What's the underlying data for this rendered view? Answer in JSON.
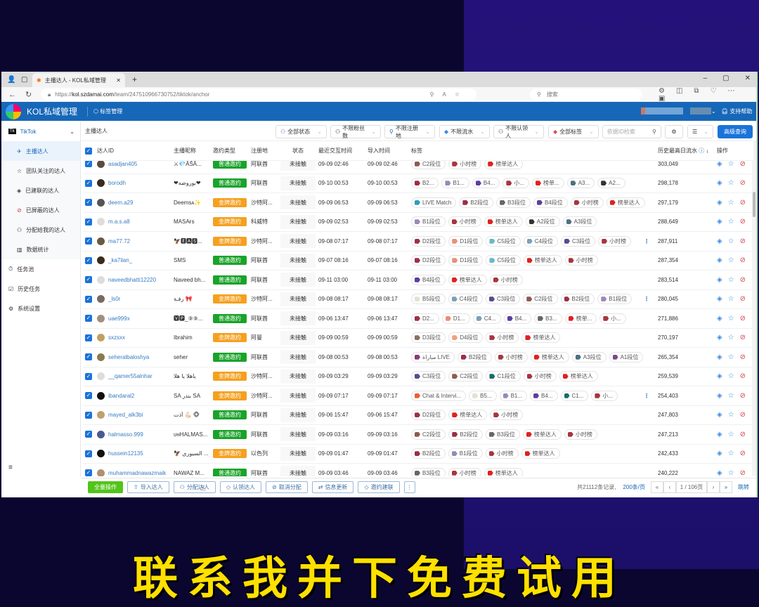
{
  "banner": {
    "bottom": "联系我并下免费试用"
  },
  "browser": {
    "tab_title": "主播达人 - KOL私域管理",
    "url_prefix": "https://",
    "url_host": "kol.szdamai.com",
    "url_path": "/team/247510966730752/tiktok/anchor",
    "search_placeholder": "搜索"
  },
  "app": {
    "title": "KOL私域管理",
    "tag_manage": "标签管理",
    "help": "支持帮助",
    "brand_color": "#1767b8"
  },
  "sidebar": {
    "platform": "TikTok",
    "items": [
      {
        "label": "主播达人",
        "icon": "anchor-icon",
        "active": true
      },
      {
        "label": "团队关注的达人",
        "icon": "star-icon"
      },
      {
        "label": "已建联的达人",
        "icon": "handshake-icon"
      },
      {
        "label": "已屏蔽的达人",
        "icon": "block-icon"
      },
      {
        "label": "分配给我的达人",
        "icon": "user-check-icon"
      },
      {
        "label": "数据统计",
        "icon": "chart-icon"
      }
    ],
    "top_items": [
      {
        "label": "任务池",
        "icon": "timer-icon"
      },
      {
        "label": "历史任务",
        "icon": "clipboard-icon"
      },
      {
        "label": "系统设置",
        "icon": "gear-icon"
      }
    ]
  },
  "filters": {
    "breadcrumb": "主播达人",
    "status": "全部状态",
    "fans": "不限粉丝数",
    "region": "不限注册地",
    "flow": "不限流水",
    "claimer": "不限认领人",
    "tags": "全部标签",
    "search_placeholder": "依据ID检索",
    "advanced": "高级查询"
  },
  "table": {
    "headers": [
      "达人ID",
      "主播昵称",
      "邀约类型",
      "注册地",
      "状态",
      "最近交互时间",
      "导入时间",
      "标签",
      "历史最高日流水",
      "操作"
    ],
    "type_colors": {
      "普通邀约": "#1aa32a",
      "金牌邀约": "#f5a020"
    },
    "tag_colors": {
      "C2段位": "#8d5a4f",
      "小时榜": "#a8343f",
      "榜单达人": "#e02020",
      "B2段位": "#9c2d44",
      "B1段位": "#9a88b8",
      "B4段位": "#5b3ea0",
      "A3段位": "#4d7080",
      "A2段位": "#333333",
      "LIVE Match": "#2aa0b8",
      "B3段位": "#666666",
      "D2段位": "#9c3048",
      "D1段位": "#e8907a",
      "C5段位": "#6ab8c8",
      "C4段位": "#7aa0b8",
      "C3段位": "#5a4a8a",
      "B5段位": "#dde4d0",
      "D3段位": "#8a7060",
      "D4段位": "#f0a080",
      "مباراة LIVE": "#8a3a7a",
      "A1段位": "#7a4a8a",
      "C1段位": "#1a6a6a",
      "Chat & Intervi": "#e86030"
    },
    "rows": [
      {
        "id": "asadjan405",
        "nick": "⚔💎ĀŠĀ...",
        "type": "普通邀约",
        "region": "阿联酋",
        "status": "未接触",
        "last": "09-09 02:46",
        "imported": "09-09 02:46",
        "tags": [
          "C2段位",
          "小时榜",
          "榜单达人"
        ],
        "more": false,
        "max": "303,049"
      },
      {
        "id": "borodh",
        "nick": "❤بوروضه❤",
        "type": "普通邀约",
        "region": "阿联酋",
        "status": "未接触",
        "last": "09-10 00:53",
        "imported": "09-10 00:53",
        "tags": [
          "B2...",
          "B1...",
          "B4...",
          "小...",
          "榜单...",
          "A3...",
          "A2..."
        ],
        "more": false,
        "max": "298,178"
      },
      {
        "id": "deem.a29",
        "nick": "Deemsᴀ✨",
        "type": "金牌邀约",
        "region": "沙特阿...",
        "status": "未接触",
        "last": "09-09 06:53",
        "imported": "09-09 06:53",
        "tags": [
          "LIVE Match",
          "B2段位",
          "B3段位",
          "B4段位",
          "小时榜",
          "榜单达人"
        ],
        "more": false,
        "max": "297,179"
      },
      {
        "id": "m.a.s.a8",
        "nick": "MASAғs",
        "type": "金牌邀约",
        "region": "科威特",
        "status": "未接触",
        "last": "09-09 02:53",
        "imported": "09-09 02:53",
        "tags": [
          "B1段位",
          "小时榜",
          "榜单达人",
          "A2段位",
          "A3段位"
        ],
        "more": false,
        "max": "288,649"
      },
      {
        "id": "ma77.72",
        "nick": "🦅🅴🅰🆂...",
        "type": "金牌邀约",
        "region": "沙特阿...",
        "status": "未接触",
        "last": "09-08 07:17",
        "imported": "09-08 07:17",
        "tags": [
          "D2段位",
          "D1段位",
          "C5段位",
          "C4段位",
          "C3段位",
          "小时榜"
        ],
        "more": true,
        "max": "287,911"
      },
      {
        "id": "_ka7ilan_",
        "nick": "SMS",
        "type": "普通邀约",
        "region": "阿联酋",
        "status": "未接触",
        "last": "09-07 08:16",
        "imported": "09-07 08:16",
        "tags": [
          "D2段位",
          "D1段位",
          "C5段位",
          "榜单达人",
          "小时榜"
        ],
        "more": false,
        "max": "287,354"
      },
      {
        "id": "naveedbhatti12220",
        "nick": "Naveed bh...",
        "type": "普通邀约",
        "region": "阿联酋",
        "status": "未接触",
        "last": "09-11 03:00",
        "imported": "09-11 03:00",
        "tags": [
          "B4段位",
          "榜单达人",
          "小时榜"
        ],
        "more": false,
        "max": "283,514"
      },
      {
        "id": "_ls0r",
        "nick": "رفـة 🎀",
        "type": "金牌邀约",
        "region": "沙特阿...",
        "status": "未接触",
        "last": "09-08 08:17",
        "imported": "09-08 08:17",
        "tags": [
          "B5段位",
          "C4段位",
          "C3段位",
          "C2段位",
          "B2段位",
          "B1段位"
        ],
        "more": true,
        "max": "280,045"
      },
      {
        "id": "uae999x",
        "nick": "🆅🅿_⑨⑨...",
        "type": "普通邀约",
        "region": "阿联酋",
        "status": "未接触",
        "last": "09-06 13:47",
        "imported": "09-06 13:47",
        "tags": [
          "D2...",
          "D1...",
          "C4...",
          "B4...",
          "B3...",
          "榜单...",
          "小..."
        ],
        "more": false,
        "max": "271,886"
      },
      {
        "id": "sxzsxx",
        "nick": "Ibrahim",
        "type": "金牌邀约",
        "region": "阿曼",
        "status": "未接触",
        "last": "09-09 00:59",
        "imported": "09-09 00:59",
        "tags": [
          "D3段位",
          "D4段位",
          "小时榜",
          "榜单达人"
        ],
        "more": false,
        "max": "270,197"
      },
      {
        "id": "seheralbaloshya",
        "nick": "seher",
        "type": "普通邀约",
        "region": "阿联酋",
        "status": "未接触",
        "last": "09-08 00:53",
        "imported": "09-08 00:53",
        "tags": [
          "مباراة LIVE",
          "B2段位",
          "小时榜",
          "榜单达人",
          "A3段位",
          "A1段位"
        ],
        "more": false,
        "max": "265,354"
      },
      {
        "id": "__qamer55alnhar",
        "nick": "ياهلا يا هلا",
        "type": "金牌邀约",
        "region": "沙特阿...",
        "status": "未接触",
        "last": "09-09 03:29",
        "imported": "09-09 03:29",
        "tags": [
          "C3段位",
          "C2段位",
          "C1段位",
          "小时榜",
          "榜单达人"
        ],
        "more": false,
        "max": "259,539"
      },
      {
        "id": "ibandaral2",
        "nick": "SA بندر SA",
        "type": "金牌邀约",
        "region": "沙特阿...",
        "status": "未接触",
        "last": "09-09 07:17",
        "imported": "09-09 07:17",
        "tags": [
          "Chat & Intervi...",
          "B5...",
          "B1...",
          "B4...",
          "C1...",
          "小..."
        ],
        "more": true,
        "max": "254,403"
      },
      {
        "id": "mayed_alk3bi",
        "nick": "أذت 💪🏻 🐵",
        "type": "普通邀约",
        "region": "阿联酋",
        "status": "未接触",
        "last": "09-06 15:47",
        "imported": "09-06 15:47",
        "tags": [
          "D2段位",
          "榜单达人",
          "小时榜"
        ],
        "more": false,
        "max": "247,803"
      },
      {
        "id": "halmasso.999",
        "nick": "ᴜʜHALMAS...",
        "type": "普通邀约",
        "region": "阿联酋",
        "status": "未接触",
        "last": "09-09 03:16",
        "imported": "09-09 03:16",
        "tags": [
          "C2段位",
          "B2段位",
          "B3段位",
          "榜单达人",
          "小时榜"
        ],
        "more": false,
        "max": "247,213"
      },
      {
        "id": "hussein12135",
        "nick": "🦅 السيوري ...",
        "type": "金牌邀约",
        "region": "以色列",
        "status": "未接触",
        "last": "09-09 01:47",
        "imported": "09-09 01:47",
        "tags": [
          "B2段位",
          "B1段位",
          "小时榜",
          "榜单达人"
        ],
        "more": false,
        "max": "242,433"
      },
      {
        "id": "muhammadnawazmaik",
        "nick": "NAWAZ M...",
        "type": "普通邀约",
        "region": "阿联酋",
        "status": "未接触",
        "last": "09-09 03:46",
        "imported": "09-09 03:46",
        "tags": [
          "B3段位",
          "小时榜",
          "榜单达人"
        ],
        "more": false,
        "max": "240,222"
      }
    ]
  },
  "footer": {
    "all_ops": "全量操作",
    "import": "导入达人",
    "assign": "分配达人",
    "claim": "认领达人",
    "unassign": "取消分配",
    "update": "信息更新",
    "invite": "邀约建联",
    "total": "共21112条记录,",
    "page_size": "200条/页",
    "page": "1 / 106页",
    "jump": "跳转"
  }
}
